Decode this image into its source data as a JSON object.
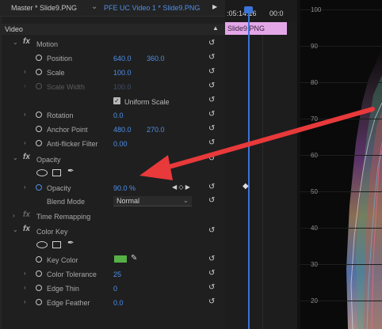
{
  "tabs": {
    "master": "Master * Slide9.PNG",
    "sequence": "PFE UC Video 1 * Slide9.PNG"
  },
  "timeline": {
    "timecode_1": ":05:14:16",
    "timecode_2": "00:0",
    "clip_label": "Slide9.PNG"
  },
  "section": {
    "video_label": "Video"
  },
  "motion": {
    "label": "Motion",
    "position_label": "Position",
    "position_x": "640.0",
    "position_y": "360.0",
    "scale_label": "Scale",
    "scale_value": "100.0",
    "scale_width_label": "Scale Width",
    "scale_width_value": "100.0",
    "uniform_scale_label": "Uniform Scale",
    "uniform_scale_checked": true,
    "rotation_label": "Rotation",
    "rotation_value": "0.0",
    "anchor_label": "Anchor Point",
    "anchor_x": "480.0",
    "anchor_y": "270.0",
    "antiflicker_label": "Anti-flicker Filter",
    "antiflicker_value": "0.00"
  },
  "opacity": {
    "label": "Opacity",
    "opacity_label": "Opacity",
    "opacity_value": "90.0 %",
    "blend_mode_label": "Blend Mode",
    "blend_mode_value": "Normal"
  },
  "time_remapping": {
    "label": "Time Remapping"
  },
  "color_key": {
    "label": "Color Key",
    "key_color_label": "Key Color",
    "key_color": "#57b046",
    "color_tolerance_label": "Color Tolerance",
    "color_tolerance_value": "25",
    "edge_thin_label": "Edge Thin",
    "edge_thin_value": "0",
    "edge_feather_label": "Edge Feather",
    "edge_feather_value": "0.0"
  },
  "scope": {
    "labels": [
      "100",
      "90",
      "80",
      "70",
      "60",
      "50",
      "40",
      "30",
      "20"
    ]
  },
  "colors": {
    "accent_blue": "#4f8fe8",
    "annotation_red": "#e8393b",
    "clip_pink": "#e3a7e8"
  }
}
